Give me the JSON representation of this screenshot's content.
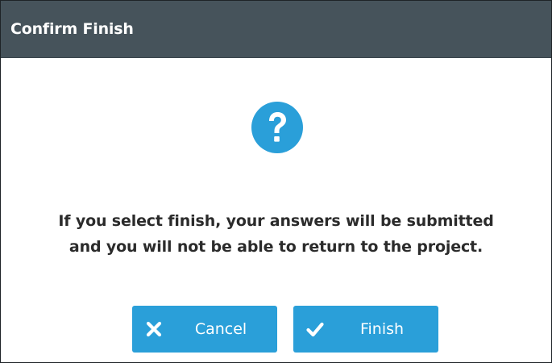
{
  "dialog": {
    "title": "Confirm Finish",
    "icon": "question-mark-circle-icon",
    "message_line1": "If you select finish, your answers will be submitted",
    "message_line2": "and you will not be able to return to the project.",
    "buttons": {
      "cancel": {
        "label": "Cancel",
        "icon": "x-icon"
      },
      "finish": {
        "label": "Finish",
        "icon": "checkmark-icon"
      }
    }
  },
  "colors": {
    "titlebar_bg": "#46535b",
    "accent": "#2a9fd9",
    "text": "#2b2b2b"
  }
}
